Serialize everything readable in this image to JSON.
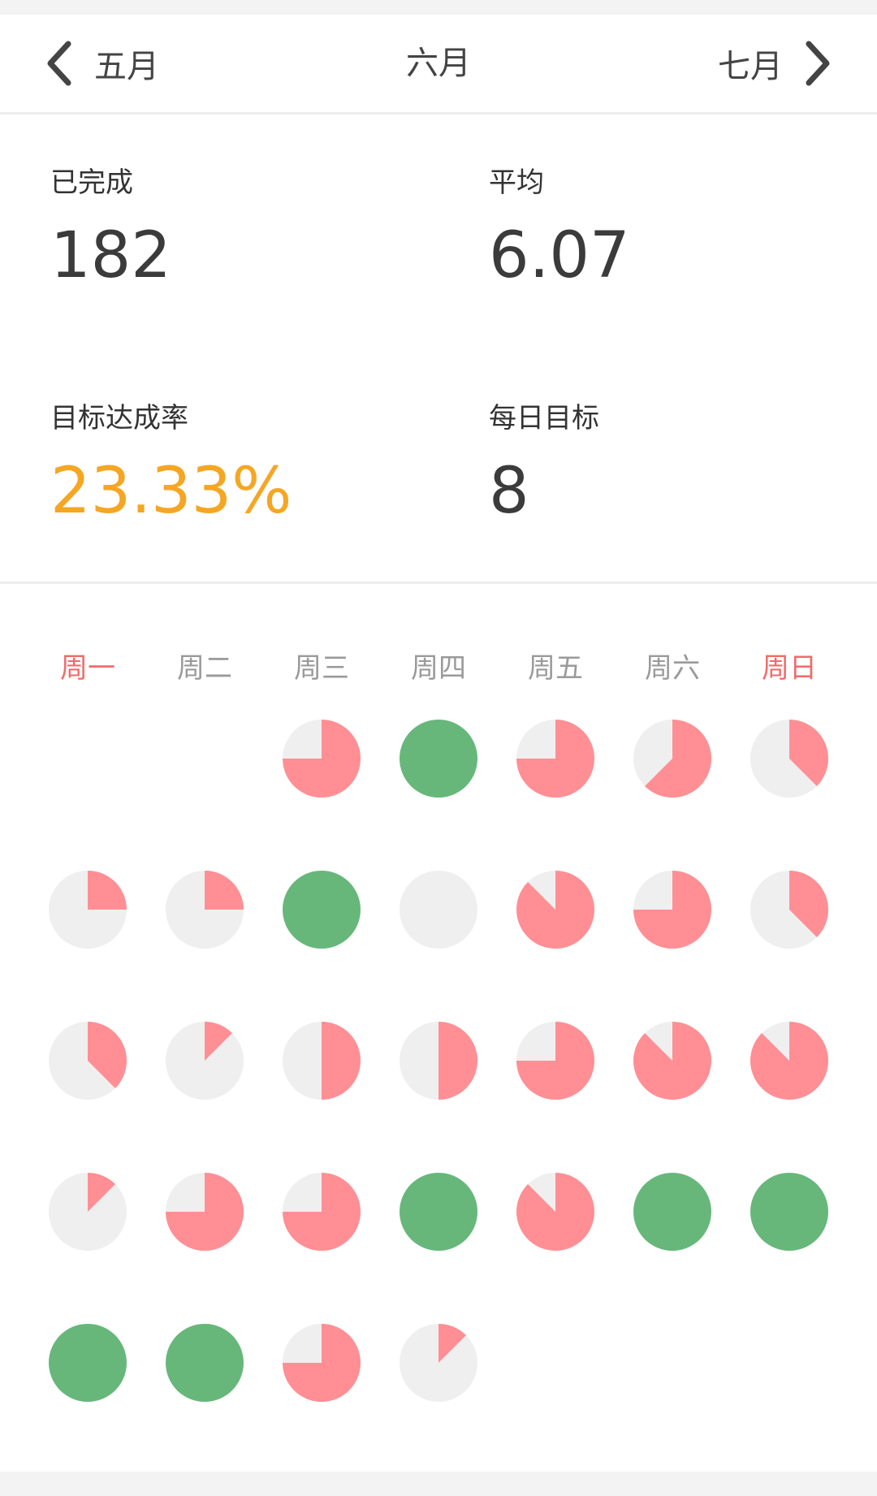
{
  "header": {
    "prev_month": "五月",
    "current_month": "六月",
    "next_month": "七月"
  },
  "stats": {
    "completed_label": "已完成",
    "completed_value": "182",
    "average_label": "平均",
    "average_value": "6.07",
    "rate_label": "目标达成率",
    "rate_value": "23.33%",
    "daily_goal_label": "每日目标",
    "daily_goal_value": "8"
  },
  "weekdays": [
    "周一",
    "周二",
    "周三",
    "周四",
    "周五",
    "周六",
    "周日"
  ],
  "colors": {
    "accent_rate": "#f5a623",
    "weekend_text": "#f16b6b",
    "weekday_text": "#9a9a9a",
    "pie_progress": "#ff8f94",
    "pie_complete": "#67b77b",
    "pie_empty": "#efefef"
  },
  "calendar": {
    "first_weekday_index": 2,
    "day_progress": [
      0.75,
      1.0,
      0.75,
      0.625,
      0.375,
      0.25,
      0.25,
      1.0,
      0.0,
      0.875,
      0.75,
      0.375,
      0.375,
      0.125,
      0.5,
      0.5,
      0.75,
      0.875,
      0.875,
      0.125,
      0.75,
      0.75,
      1.0,
      0.875,
      1.0,
      1.0,
      1.0,
      1.0,
      0.75,
      0.125
    ]
  }
}
